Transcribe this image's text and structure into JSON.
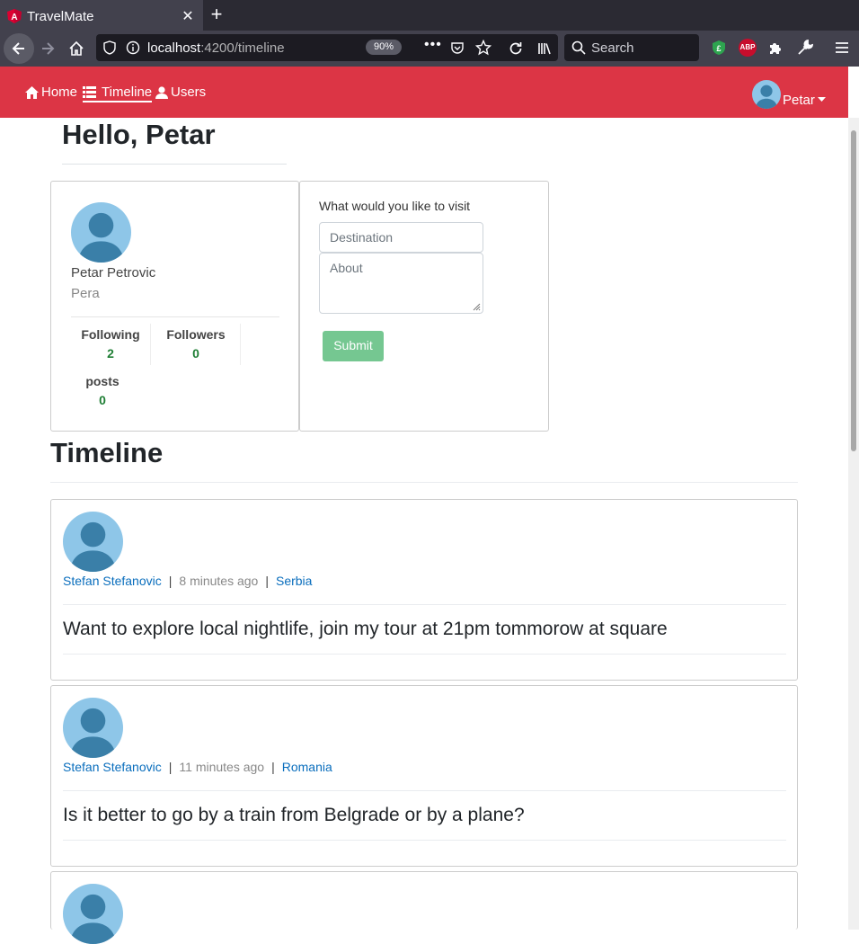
{
  "browser": {
    "tab_title": "TravelMate",
    "url_host": "localhost",
    "url_path": ":4200/timeline",
    "zoom": "90%",
    "search_placeholder": "Search",
    "abp_label": "ABP"
  },
  "nav": {
    "home": "Home",
    "timeline": "Timeline",
    "users": "Users",
    "user_name": "Petar",
    "brand_color": "#dc3545"
  },
  "greeting": "Hello, Petar",
  "profile": {
    "full_name": "Petar Petrovic",
    "username": "Pera",
    "following_label": "Following",
    "following_count": "2",
    "followers_label": "Followers",
    "followers_count": "0",
    "posts_label": "posts",
    "posts_count": "0"
  },
  "new_post": {
    "prompt": "What would you like to visit",
    "destination_placeholder": "Destination",
    "about_placeholder": "About",
    "submit_label": "Submit"
  },
  "timeline": {
    "title": "Timeline",
    "posts": [
      {
        "author": "Stefan Stefanovic",
        "time": "8 minutes ago",
        "country": "Serbia",
        "text": "Want to explore local nightlife, join my tour at 21pm tommorow at square"
      },
      {
        "author": "Stefan Stefanovic",
        "time": "11 minutes ago",
        "country": "Romania",
        "text": "Is it better to go by a train from Belgrade or by a plane?"
      }
    ]
  }
}
